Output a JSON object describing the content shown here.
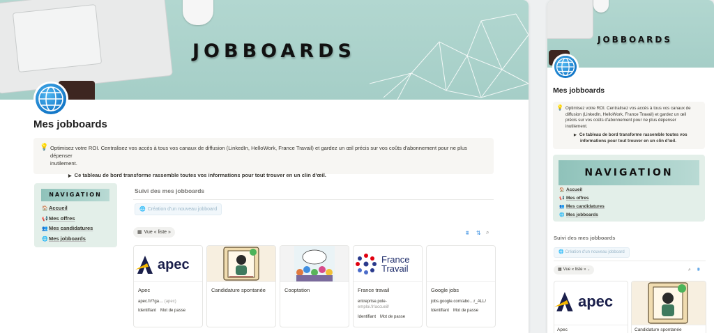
{
  "page": {
    "title": "Mes jobboards",
    "cover_title": "JOBBOARDS",
    "callout": {
      "icon": "lightbulb-icon",
      "text": "Optimisez votre ROI. Centralisez vos accès à tous vos canaux de diffusion (LinkedIn, HelloWork, France Travail) et gardez un œil précis sur vos coûts d'abonnement pour ne plus dépenser inutilement.",
      "desktop_line1": "Optimisez votre ROI. Centralisez vos accès à tous vos canaux de diffusion (LinkedIn, HelloWork, France Travail) et gardez un œil précis sur vos coûts d'abonnement pour ne plus dépenser",
      "desktop_line2": "inutilement.",
      "mobile_line1": "Optimisez votre ROI. Centralisez vos accès à tous vos canaux de",
      "mobile_line2": "diffusion (LinkedIn, HelloWork, France Travail) et gardez un œil",
      "mobile_line3": "précis sur vos coûts d'abonnement pour ne plus dépenser",
      "mobile_line4": "inutilement.",
      "bullet": "Ce tableau de bord transforme rassemble toutes vos informations pour tout trouver en un clin d'œil.",
      "bullet_m1": "Ce tableau de bord transforme rassemble toutes vos",
      "bullet_m2": "informations pour tout trouver en un clin d'œil."
    }
  },
  "navigation": {
    "title": "NAVIGATION",
    "items": [
      {
        "icon": "house-icon",
        "label": "Accueil"
      },
      {
        "icon": "megaphone-icon",
        "label": "Mes offres"
      },
      {
        "icon": "people-icon",
        "label": "Mes candidatures"
      },
      {
        "icon": "globe-icon",
        "label": "Mes jobboards"
      }
    ]
  },
  "database": {
    "title": "Suivi des mes jobboards",
    "new_button": "Création d'un nouveau jobboard",
    "view_label": "Vue « liste »",
    "cards": [
      {
        "title": "Apec",
        "url": "apec.fr/?ga…",
        "url_extra": "(apec)",
        "tags": [
          "Identifiant",
          "Mot de passe"
        ],
        "logo": "apec"
      },
      {
        "title": "Candidature spontanée",
        "url": "",
        "url_extra": "",
        "tags": [],
        "logo": "cv-illustration"
      },
      {
        "title": "Cooptation",
        "url": "",
        "url_extra": "",
        "tags": [],
        "logo": "crowd-illustration"
      },
      {
        "title": "France travail",
        "url": "entreprise.pole-",
        "url_line2": "emploi.fr/accueil/",
        "tags": [
          "Identifiant",
          "Mot de passe"
        ],
        "logo": "france-travail"
      },
      {
        "title": "Google jobs",
        "url": "jobs.google.com/abo…r_ALL/",
        "url_extra": "",
        "tags": [
          "Identifiant",
          "Mot de passe"
        ],
        "logo": "blank"
      }
    ]
  },
  "logos": {
    "apec_text": "apec",
    "ft_line1": "France",
    "ft_line2": "Travail"
  },
  "colors": {
    "cover": "#a5cec7",
    "nav_box": "#e3efe9",
    "accent_blue": "#2f8ae0",
    "apec_navy": "#1a1f4b",
    "apec_yellow": "#f5b800"
  }
}
